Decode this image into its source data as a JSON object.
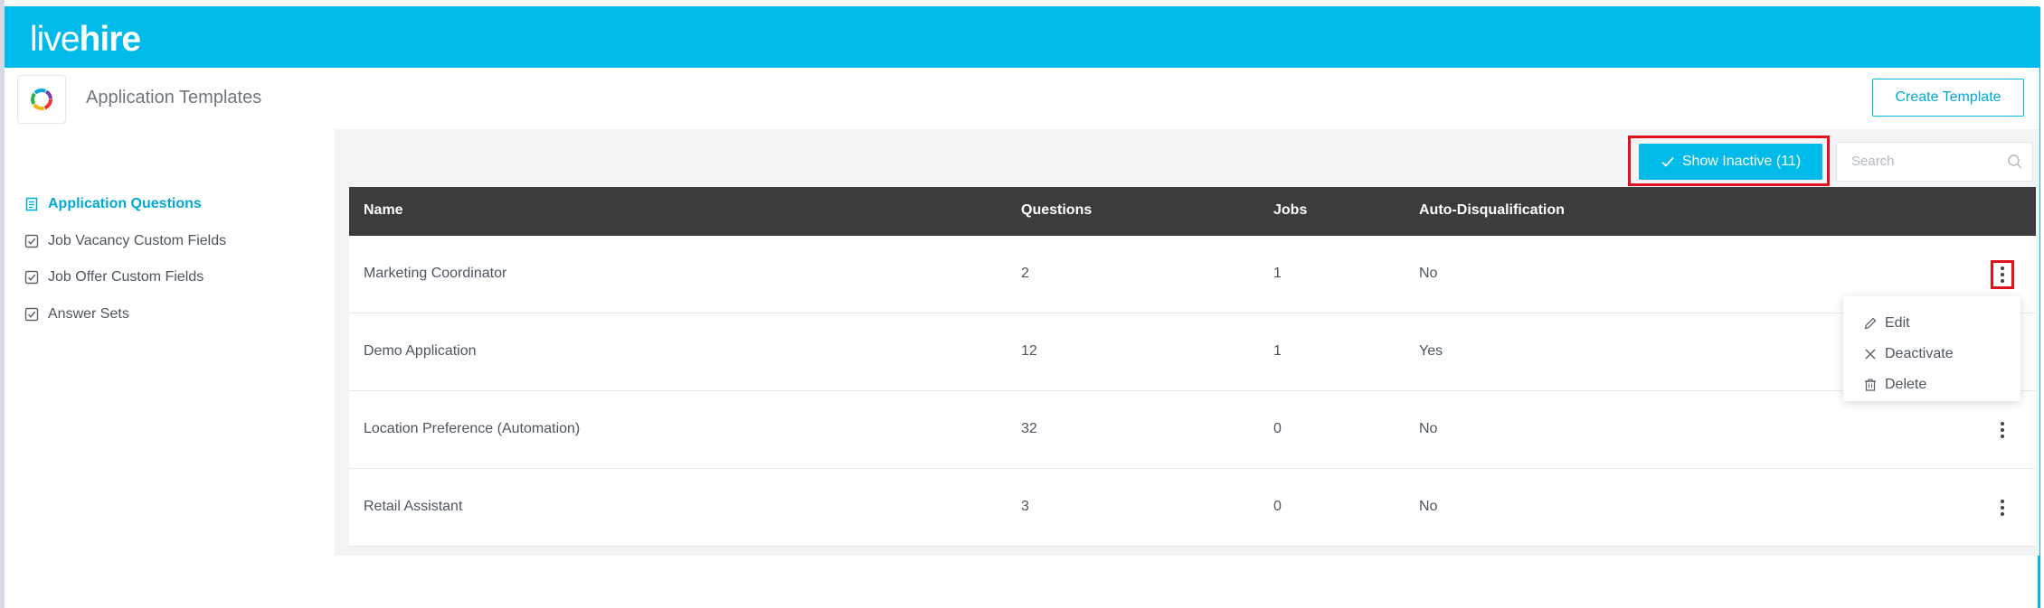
{
  "brand": {
    "logo_thin": "live",
    "logo_bold": "hire",
    "accent": "#00bbea",
    "highlight": "#e1101e"
  },
  "header": {
    "title": "Application Templates",
    "create_label": "Create Template",
    "app_icon": "livehire-swirl-icon"
  },
  "sidebar": {
    "items": [
      {
        "label": "Application Questions",
        "icon": "document-icon",
        "active": true
      },
      {
        "label": "Job Vacancy Custom Fields",
        "icon": "checkbox-icon",
        "active": false
      },
      {
        "label": "Job Offer Custom Fields",
        "icon": "checkbox-icon",
        "active": false
      },
      {
        "label": "Answer Sets",
        "icon": "checkbox-icon",
        "active": false
      }
    ]
  },
  "toolbar": {
    "show_inactive_label": "Show Inactive (11)",
    "search_placeholder": "Search"
  },
  "table": {
    "headers": [
      "Name",
      "Questions",
      "Jobs",
      "Auto-Disqualification"
    ],
    "rows": [
      {
        "name": "Marketing Coordinator",
        "questions": "2",
        "jobs": "1",
        "auto_dq": "No"
      },
      {
        "name": "Demo Application",
        "questions": "12",
        "jobs": "1",
        "auto_dq": "Yes"
      },
      {
        "name": "Location Preference (Automation)",
        "questions": "32",
        "jobs": "0",
        "auto_dq": "No"
      },
      {
        "name": "Retail Assistant",
        "questions": "3",
        "jobs": "0",
        "auto_dq": "No"
      }
    ]
  },
  "context_menu": {
    "items": [
      {
        "label": "Edit",
        "icon": "pencil-icon"
      },
      {
        "label": "Deactivate",
        "icon": "close-icon"
      },
      {
        "label": "Delete",
        "icon": "trash-icon"
      }
    ]
  }
}
